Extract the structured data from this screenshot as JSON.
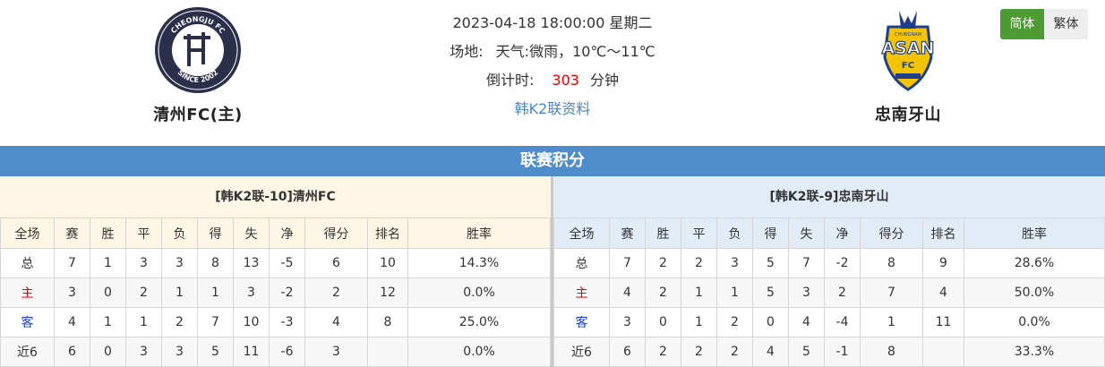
{
  "match": {
    "datetime": "2023-04-18 18:00:00 星期二",
    "venue_label": "场地:",
    "weather_label": "天气:",
    "weather_value": "微雨，10℃～11℃",
    "countdown_label": "倒计时:",
    "countdown_value": "303",
    "countdown_unit": "分钟",
    "league_link": "韩K2联资料"
  },
  "home_team": {
    "name": "清州FC(主)",
    "logo_top_text": "CHEONGJU FC",
    "logo_bottom_text": "SINCE 2002"
  },
  "away_team": {
    "name": "忠南牙山",
    "logo_text": "ASAN",
    "logo_top_text": "CHUNGNAM",
    "logo_sub_text": "FC"
  },
  "lang": {
    "simplified": "简体",
    "traditional": "繁体"
  },
  "section_title": "联赛积分",
  "columns": [
    "全场",
    "赛",
    "胜",
    "平",
    "负",
    "得",
    "失",
    "净",
    "得分",
    "排名",
    "胜率"
  ],
  "home_standings": {
    "title": "[韩K2联-10]清州FC",
    "rows": [
      {
        "scope": "总",
        "played": "7",
        "win": "1",
        "draw": "3",
        "loss": "3",
        "gf": "8",
        "ga": "13",
        "gd": "-5",
        "pts": "6",
        "rank": "10",
        "rate": "14.3%"
      },
      {
        "scope": "主",
        "played": "3",
        "win": "0",
        "draw": "2",
        "loss": "1",
        "gf": "1",
        "ga": "3",
        "gd": "-2",
        "pts": "2",
        "rank": "12",
        "rate": "0.0%"
      },
      {
        "scope": "客",
        "played": "4",
        "win": "1",
        "draw": "1",
        "loss": "2",
        "gf": "7",
        "ga": "10",
        "gd": "-3",
        "pts": "4",
        "rank": "8",
        "rate": "25.0%"
      },
      {
        "scope": "近6",
        "played": "6",
        "win": "0",
        "draw": "3",
        "loss": "3",
        "gf": "5",
        "ga": "11",
        "gd": "-6",
        "pts": "3",
        "rank": "",
        "rate": "0.0%"
      }
    ]
  },
  "away_standings": {
    "title": "[韩K2联-9]忠南牙山",
    "rows": [
      {
        "scope": "总",
        "played": "7",
        "win": "2",
        "draw": "2",
        "loss": "3",
        "gf": "5",
        "ga": "7",
        "gd": "-2",
        "pts": "8",
        "rank": "9",
        "rate": "28.6%"
      },
      {
        "scope": "主",
        "played": "4",
        "win": "2",
        "draw": "1",
        "loss": "1",
        "gf": "5",
        "ga": "3",
        "gd": "2",
        "pts": "7",
        "rank": "4",
        "rate": "50.0%"
      },
      {
        "scope": "客",
        "played": "3",
        "win": "0",
        "draw": "1",
        "loss": "2",
        "gf": "0",
        "ga": "4",
        "gd": "-4",
        "pts": "1",
        "rank": "11",
        "rate": "0.0%"
      },
      {
        "scope": "近6",
        "played": "6",
        "win": "2",
        "draw": "2",
        "loss": "2",
        "gf": "4",
        "ga": "5",
        "gd": "-1",
        "pts": "8",
        "rank": "",
        "rate": "33.3%"
      }
    ]
  },
  "colors": {
    "section_bar": "#4e8ccb",
    "home_panel_bg": "#fdf6e5",
    "away_panel_bg": "#e2ecf6",
    "home_row_label": "#e00000",
    "away_row_label": "#1a3fd6",
    "countdown": "#e00000",
    "lang_active": "#4e9a33"
  }
}
